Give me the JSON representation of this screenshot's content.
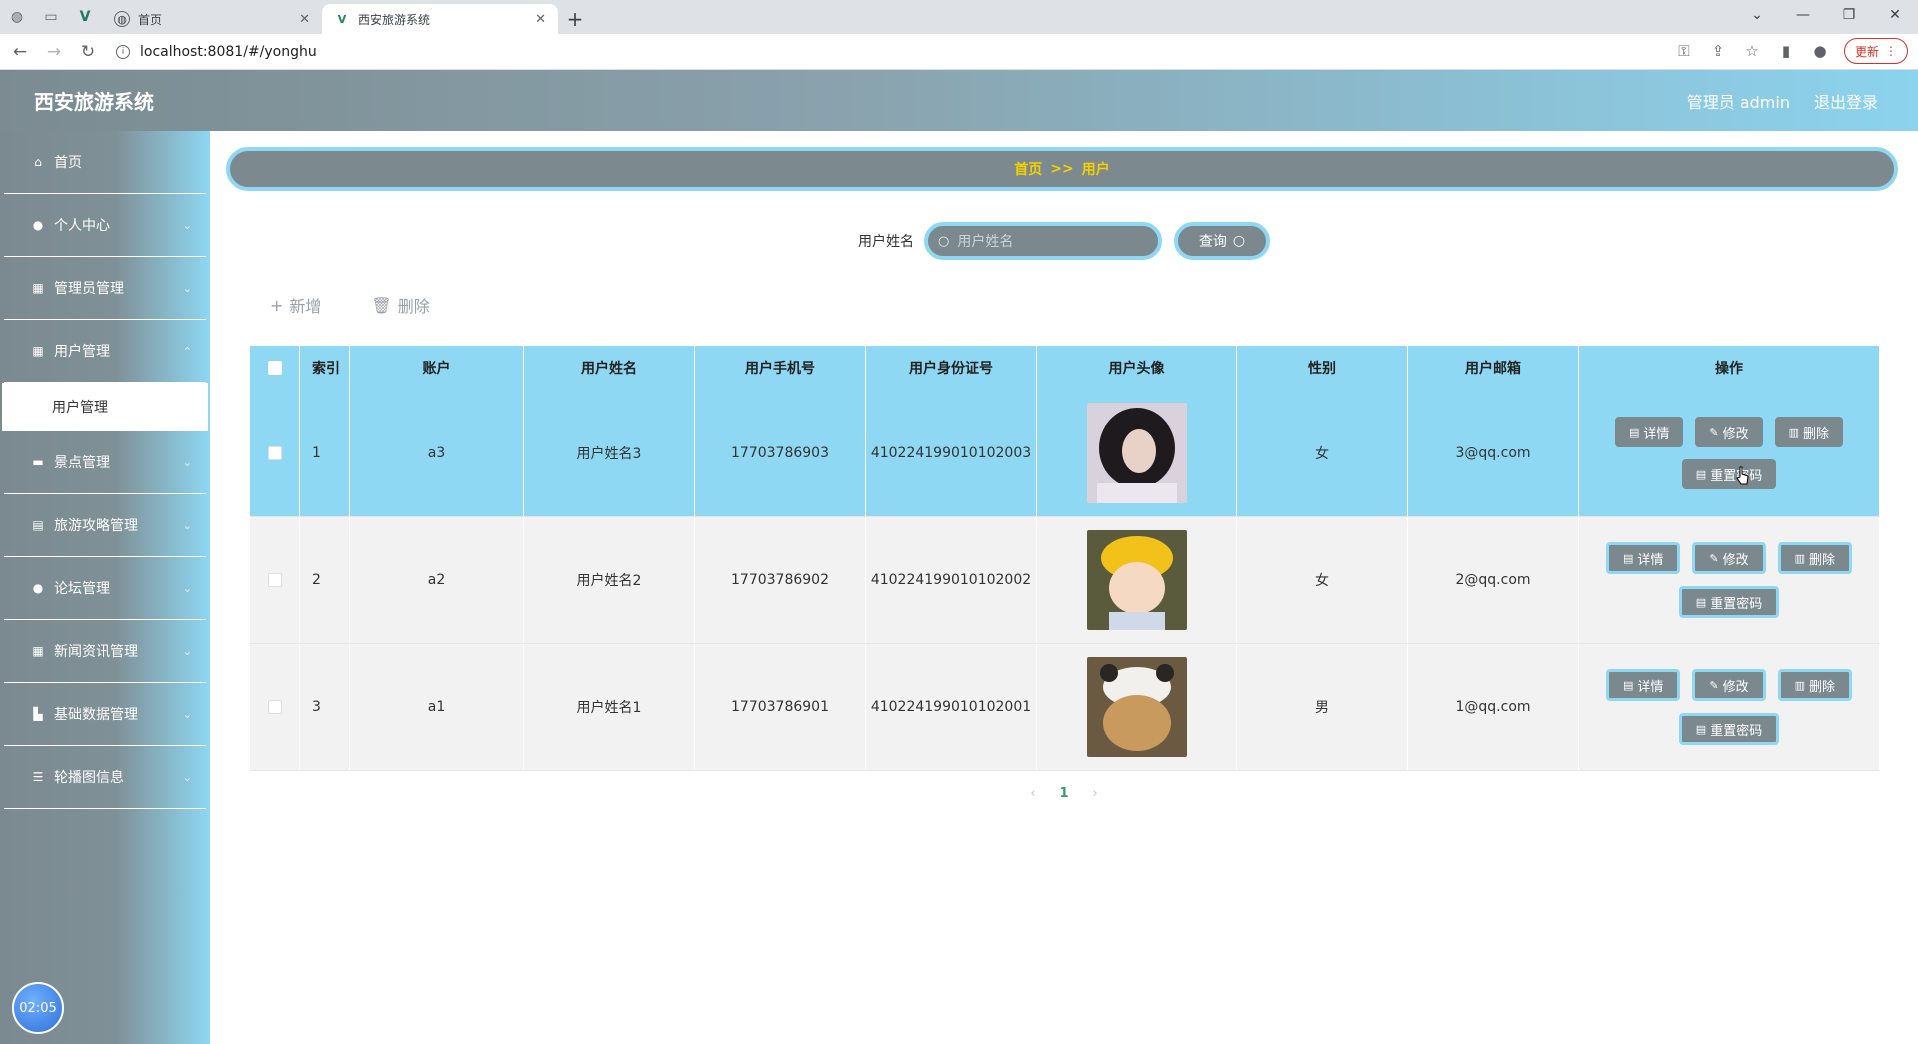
{
  "browser": {
    "tabs": [
      {
        "title": "首页",
        "active": false
      },
      {
        "title": "西安旅游系统",
        "active": true
      }
    ],
    "url": "localhost:8081/#/yonghu",
    "update_label": "更新"
  },
  "header": {
    "title": "西安旅游系统",
    "admin_label": "管理员 admin",
    "logout_label": "退出登录"
  },
  "sidebar": {
    "items": [
      {
        "label": "首页",
        "icon": "home-icon"
      },
      {
        "label": "个人中心",
        "icon": "user-icon"
      },
      {
        "label": "管理员管理",
        "icon": "grid-icon"
      },
      {
        "label": "用户管理",
        "icon": "grid-icon"
      },
      {
        "label": "景点管理",
        "icon": "chat-icon"
      },
      {
        "label": "旅游攻略管理",
        "icon": "clipboard-icon"
      },
      {
        "label": "论坛管理",
        "icon": "user-icon"
      },
      {
        "label": "新闻资讯管理",
        "icon": "grid-icon"
      },
      {
        "label": "基础数据管理",
        "icon": "stack-icon"
      },
      {
        "label": "轮播图信息",
        "icon": "menu-icon"
      }
    ],
    "active_sub": "用户管理",
    "clock": "02:05"
  },
  "breadcrumb": {
    "home": "首页",
    "sep": ">>",
    "current": "用户"
  },
  "search": {
    "label": "用户姓名",
    "placeholder": "用户姓名",
    "button": "查询"
  },
  "actions": {
    "add": "新增",
    "delete": "删除"
  },
  "table": {
    "headers": [
      "索引",
      "账户",
      "用户姓名",
      "用户手机号",
      "用户身份证号",
      "用户头像",
      "性别",
      "用户邮箱",
      "操作"
    ],
    "rows": [
      {
        "index": "1",
        "account": "a3",
        "name": "用户姓名3",
        "phone": "17703786903",
        "idcard": "410224199010102003",
        "gender": "女",
        "email": "3@qq.com"
      },
      {
        "index": "2",
        "account": "a2",
        "name": "用户姓名2",
        "phone": "17703786902",
        "idcard": "410224199010102002",
        "gender": "女",
        "email": "2@qq.com"
      },
      {
        "index": "3",
        "account": "a1",
        "name": "用户姓名1",
        "phone": "17703786901",
        "idcard": "410224199010102001",
        "gender": "男",
        "email": "1@qq.com"
      }
    ],
    "ops": {
      "detail": "详情",
      "edit": "修改",
      "delete": "删除",
      "reset": "重置密码"
    }
  },
  "pager": {
    "current": "1"
  }
}
